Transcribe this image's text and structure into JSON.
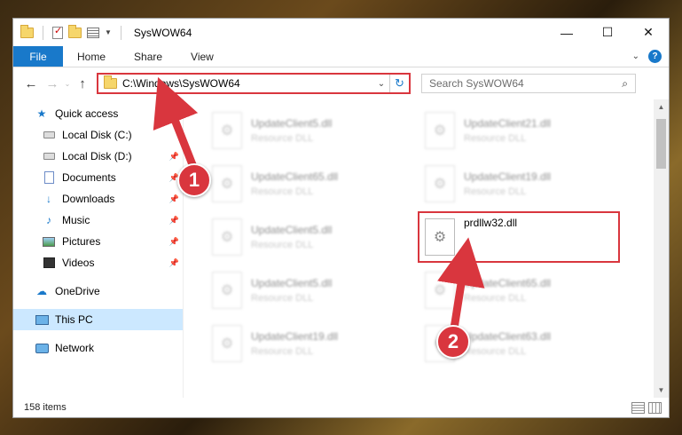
{
  "window": {
    "title": "SysWOW64",
    "controls": {
      "minimize": "—",
      "maximize": "☐",
      "close": "✕"
    }
  },
  "ribbon": {
    "file_tab": "File",
    "tabs": [
      "Home",
      "Share",
      "View"
    ]
  },
  "address": {
    "path": "C:\\Windows\\SysWOW64",
    "search_placeholder": "Search SysWOW64"
  },
  "navigation": {
    "quick_access": "Quick access",
    "items": [
      {
        "label": "Local Disk (C:)",
        "icon": "drive-icon",
        "pinned": true
      },
      {
        "label": "Local Disk (D:)",
        "icon": "drive-icon",
        "pinned": true
      },
      {
        "label": "Documents",
        "icon": "documents-icon",
        "pinned": true
      },
      {
        "label": "Downloads",
        "icon": "downloads-icon",
        "pinned": true
      },
      {
        "label": "Music",
        "icon": "music-icon",
        "pinned": true
      },
      {
        "label": "Pictures",
        "icon": "pictures-icon",
        "pinned": true
      },
      {
        "label": "Videos",
        "icon": "videos-icon",
        "pinned": true
      }
    ],
    "onedrive": "OneDrive",
    "this_pc": "This PC",
    "network": "Network"
  },
  "files": [
    {
      "name": "UpdateClient5.dll",
      "type": "Resource DLL",
      "blurred": true
    },
    {
      "name": "UpdateClient21.dll",
      "type": "Resource DLL",
      "blurred": true
    },
    {
      "name": "UpdateClient65.dll",
      "type": "Resource DLL",
      "blurred": true
    },
    {
      "name": "UpdateClient19.dll",
      "type": "Resource DLL",
      "blurred": true
    },
    {
      "name": "UpdateClient5.dll",
      "type": "Resource DLL",
      "blurred": true
    },
    {
      "name": "prdllw32.dll",
      "type": "",
      "blurred": false
    },
    {
      "name": "UpdateClient5.dll",
      "type": "Resource DLL",
      "blurred": true
    },
    {
      "name": "UpdateClient65.dll",
      "type": "Resource DLL",
      "blurred": true
    },
    {
      "name": "UpdateClient19.dll",
      "type": "Resource DLL",
      "blurred": true
    },
    {
      "name": "UpdateClient63.dll",
      "type": "Resource DLL",
      "blurred": true
    }
  ],
  "status": {
    "item_count": "158 items"
  },
  "annotations": {
    "step1": "1",
    "step2": "2",
    "color": "#d9363e"
  }
}
